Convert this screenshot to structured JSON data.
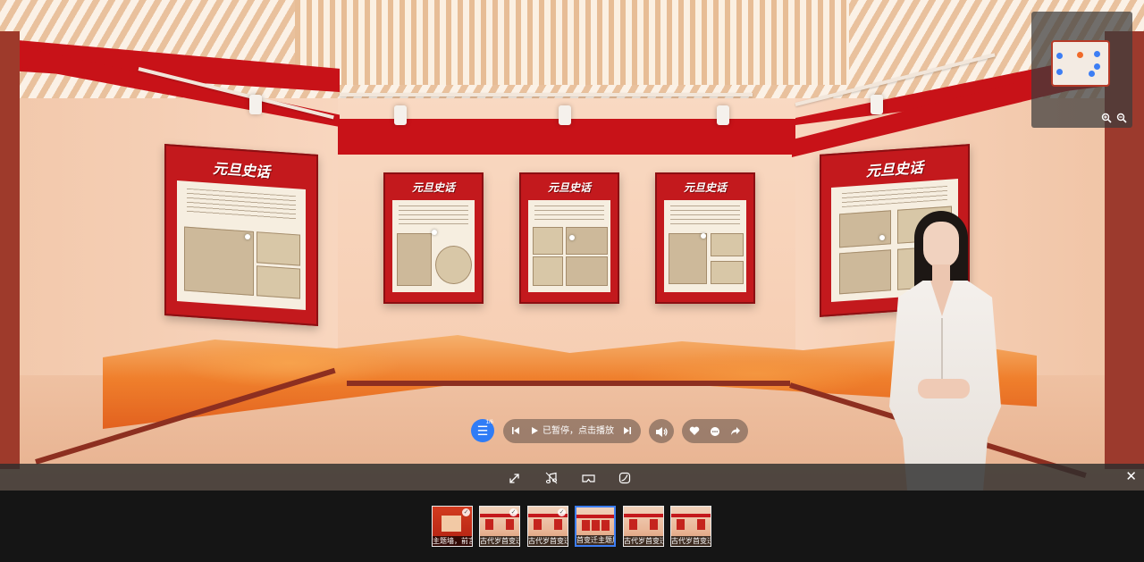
{
  "scene": {
    "poster_title": "元旦史话"
  },
  "player": {
    "status": "已暂停，点击播放",
    "menu_badge": "1/6"
  },
  "thumbnails": [
    {
      "label": "主题墙，前言"
    },
    {
      "label": "古代岁首变迁"
    },
    {
      "label": "古代岁首变迁"
    },
    {
      "label": "首变迁主题展"
    },
    {
      "label": "古代岁首变迁"
    },
    {
      "label": "古代岁首变迁"
    }
  ],
  "active_thumbnail": 3,
  "colors": {
    "accent": "#2f7cf6",
    "brand_red": "#c81218"
  },
  "icons": {
    "menu": "list-icon",
    "prev": "skip-previous-icon",
    "play": "play-icon",
    "next": "skip-next-icon",
    "volume": "speaker-icon",
    "like": "heart-icon",
    "comment": "comment-icon",
    "share": "share-icon",
    "fullscreen": "expand-icon",
    "music": "music-note-icon",
    "vr": "vr-glasses-icon",
    "gyro": "gyroscope-icon",
    "close": "close-icon",
    "zoom_in": "zoom-in-icon",
    "zoom_out": "zoom-out-icon"
  }
}
